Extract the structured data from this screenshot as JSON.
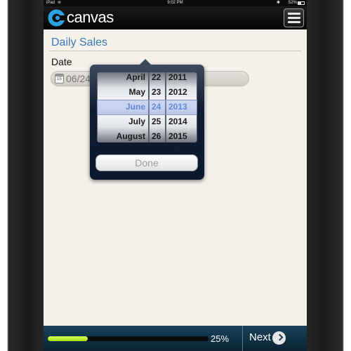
{
  "status_bar": {
    "carrier": "iPad",
    "time": "9:02 PM",
    "battery": "52%"
  },
  "app_bar": {
    "brand": "canvas",
    "menu_icon": "menu-icon"
  },
  "form": {
    "title": "Daily Sales",
    "date_label": "Date",
    "date_value": "06/24/2013",
    "calendar_icon_day": "15"
  },
  "picker": {
    "months": [
      "April",
      "May",
      "June",
      "July",
      "August"
    ],
    "days": [
      "22",
      "23",
      "24",
      "25",
      "26"
    ],
    "years": [
      "2011",
      "2012",
      "2013",
      "2014",
      "2015"
    ],
    "selected_index": 2,
    "done_label": "Done"
  },
  "footer": {
    "progress": 0.25,
    "progress_text": "25%",
    "next_label": "Next"
  },
  "colors": {
    "accent_blue": "#3e77b8",
    "progress_fill": "#b8f020",
    "footer_bg": "#0f3045"
  }
}
